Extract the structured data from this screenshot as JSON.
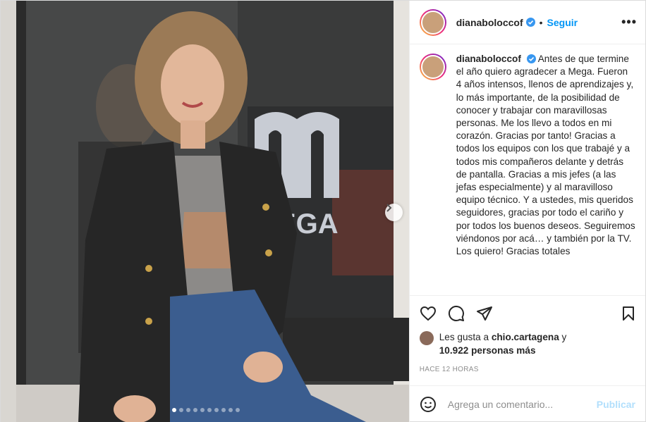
{
  "post": {
    "username": "dianaboloccof",
    "separator": "•",
    "follow_label": "Seguir",
    "more_label": "•••",
    "caption": "Antes de que termine el año quiero agradecer a Mega. Fueron 4 años intensos, llenos de aprendizajes y, lo más importante, de la posibilidad de conocer y trabajar con maravillosas personas. Me los llevo a todos en mi corazón. Gracias por tanto! Gracias a todos los equipos con los que trabajé y a todos mis compañeros delante y detrás de pantalla. Gracias a mis jefes (a las jefas especialmente) y al maravilloso equipo técnico. Y a ustedes, mis queridos seguidores, gracias por todo el cariño y por todos los buenos deseos. Seguiremos viéndonos por acá… y también por la TV. Los quiero! Gracias totales",
    "likes_prefix": "Les gusta a",
    "likes_user": "chio.cartagena",
    "likes_and": "y",
    "likes_count": "10.922 personas más",
    "time_ago": "HACE 12 HORAS",
    "comment_placeholder": "Agrega un comentario...",
    "publish_label": "Publicar",
    "media_sign_text": "EGA",
    "carousel": {
      "total": 10,
      "active": 1
    }
  },
  "icons": [
    "verified-badge-icon",
    "heart-icon",
    "comment-icon",
    "share-icon",
    "bookmark-icon",
    "emoji-icon",
    "chevron-right-icon"
  ],
  "colors": {
    "accent": "#0095f6",
    "publish_disabled": "#b2dffc",
    "verified": "#3897f0",
    "text": "#262626",
    "muted": "#8e8e8e"
  }
}
